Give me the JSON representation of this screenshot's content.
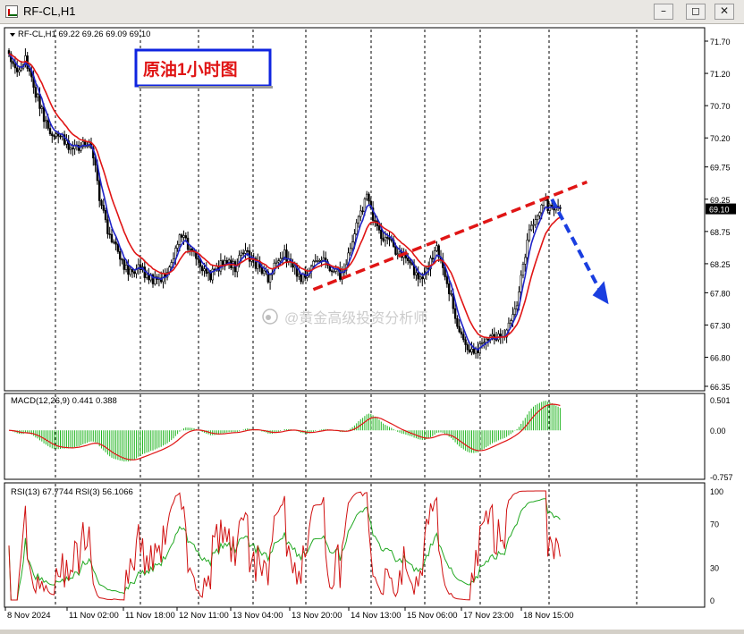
{
  "window": {
    "title": "RF-CL,H1",
    "minimize_icon": "minimize-icon",
    "restore_icon": "restore-icon",
    "close_icon": "close-icon"
  },
  "colors": {
    "price": "#000000",
    "ma_fast": "#1f23c8",
    "ma_slow": "#e01515",
    "macd_hist": "#21b521",
    "macd_signal": "#e01515",
    "rsi13": "#22a822",
    "rsi3": "#d01010",
    "trendline": "#e01515",
    "forecast_arrow": "#1a3ee0",
    "annotation_border": "#0f24e0",
    "annotation_text": "#e01515"
  },
  "chart_data": [
    {
      "type": "candlestick",
      "header": "RF-CL,H1  69.22 69.26 69.09 69.10",
      "annotation": "原油1小时图",
      "watermark": "@黄金高级投资分析师",
      "current_price": 69.1,
      "current_price_label": "69.10",
      "y_ticks": [
        "71.70",
        "71.20",
        "70.70",
        "70.20",
        "69.75",
        "69.25",
        "68.75",
        "68.25",
        "67.80",
        "67.30",
        "66.80",
        "66.35"
      ],
      "ylim": [
        66.35,
        71.7
      ],
      "x_ticks": [
        "8 Nov 2024",
        "11 Nov 02:00",
        "11 Nov 18:00",
        "12 Nov 11:00",
        "13 Nov 04:00",
        "13 Nov 20:00",
        "14 Nov 13:00",
        "15 Nov 06:00",
        "17 Nov 23:00",
        "18 Nov 15:00"
      ],
      "path": [
        [
          0,
          71.5
        ],
        [
          4,
          71.2
        ],
        [
          8,
          71.4
        ],
        [
          12,
          71.0
        ],
        [
          16,
          70.6
        ],
        [
          20,
          70.25
        ],
        [
          25,
          70.3
        ],
        [
          30,
          70.0
        ],
        [
          36,
          70.1
        ],
        [
          40,
          70.1
        ],
        [
          44,
          69.3
        ],
        [
          48,
          68.75
        ],
        [
          54,
          68.35
        ],
        [
          58,
          68.1
        ],
        [
          62,
          68.2
        ],
        [
          68,
          68.05
        ],
        [
          72,
          67.95
        ],
        [
          76,
          68.1
        ],
        [
          80,
          68.4
        ],
        [
          84,
          68.7
        ],
        [
          88,
          68.5
        ],
        [
          92,
          68.3
        ],
        [
          98,
          68.05
        ],
        [
          102,
          68.2
        ],
        [
          106,
          68.3
        ],
        [
          110,
          68.2
        ],
        [
          114,
          68.45
        ],
        [
          118,
          68.3
        ],
        [
          122,
          68.2
        ],
        [
          126,
          68.0
        ],
        [
          130,
          68.25
        ],
        [
          134,
          68.4
        ],
        [
          140,
          68.1
        ],
        [
          144,
          68.0
        ],
        [
          148,
          68.25
        ],
        [
          152,
          68.3
        ],
        [
          156,
          68.2
        ],
        [
          162,
          68.05
        ],
        [
          166,
          68.45
        ],
        [
          170,
          68.95
        ],
        [
          174,
          69.25
        ],
        [
          178,
          68.9
        ],
        [
          182,
          68.6
        ],
        [
          186,
          68.55
        ],
        [
          190,
          68.4
        ],
        [
          194,
          68.3
        ],
        [
          200,
          68.0
        ],
        [
          204,
          68.2
        ],
        [
          208,
          68.5
        ],
        [
          212,
          68.1
        ],
        [
          216,
          67.6
        ],
        [
          220,
          67.1
        ],
        [
          224,
          66.95
        ],
        [
          228,
          66.9
        ],
        [
          232,
          67.05
        ],
        [
          236,
          67.15
        ],
        [
          240,
          67.15
        ],
        [
          244,
          67.3
        ],
        [
          248,
          67.8
        ],
        [
          252,
          68.6
        ],
        [
          256,
          69.0
        ],
        [
          260,
          69.2
        ],
        [
          264,
          69.1
        ],
        [
          266,
          69.15
        ],
        [
          268,
          69.1
        ]
      ],
      "n_bars": 269,
      "moving_averages": [
        {
          "role": "fast",
          "period": 5,
          "color_key": "ma_fast"
        },
        {
          "role": "slow",
          "period": 14,
          "color_key": "ma_slow"
        }
      ],
      "trendline": {
        "from": [
          148,
          67.85
        ],
        "to": [
          268,
          69.35
        ],
        "style": "dashed"
      },
      "forecast_arrow": {
        "from": [
          264,
          69.25
        ],
        "to": [
          282,
          67.65
        ],
        "style": "dashed"
      }
    },
    {
      "type": "bar",
      "title": "MACD(12,26,9) 0.441 0.388",
      "y_ticks": [
        "0.501",
        "0.00",
        "-0.757"
      ],
      "ylim": [
        -0.757,
        0.501
      ],
      "fast": 12,
      "slow": 26,
      "signal": 9,
      "series": [
        {
          "name": "MACD",
          "color_key": "macd_hist"
        },
        {
          "name": "Signal",
          "color_key": "macd_signal"
        }
      ]
    },
    {
      "type": "line",
      "title": "RSI(13) 67.7744  RSI(3) 56.1066",
      "y_ticks": [
        "100",
        "70",
        "30",
        "0"
      ],
      "ylim": [
        0,
        100
      ],
      "series": [
        {
          "name": "RSI(13)",
          "period": 13,
          "color_key": "rsi13"
        },
        {
          "name": "RSI(3)",
          "period": 3,
          "color_key": "rsi3"
        }
      ]
    }
  ]
}
